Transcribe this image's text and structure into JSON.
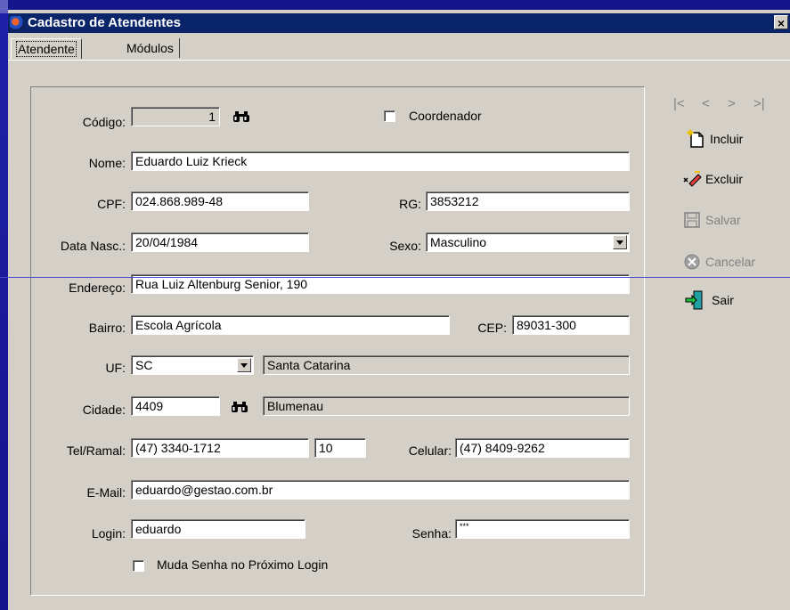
{
  "window": {
    "title": "Cadastro de Atendentes",
    "close_glyph": "×"
  },
  "tabs": [
    {
      "label": "Atendente"
    },
    {
      "label": "Módulos"
    }
  ],
  "form": {
    "codigo": {
      "label": "Código:",
      "value": "1"
    },
    "coordenador": {
      "label": "Coordenador",
      "checked": false
    },
    "nome": {
      "label": "Nome:",
      "value": "Eduardo Luiz Krieck"
    },
    "cpf": {
      "label": "CPF:",
      "value": "024.868.989-48"
    },
    "rg": {
      "label": "RG:",
      "value": "3853212"
    },
    "data_nasc": {
      "label": "Data Nasc.:",
      "value": "20/04/1984"
    },
    "sexo": {
      "label": "Sexo:",
      "value": "Masculino"
    },
    "endereco": {
      "label": "Endereço:",
      "value": "Rua Luiz Altenburg Senior, 190"
    },
    "bairro": {
      "label": "Bairro:",
      "value": "Escola Agrícola"
    },
    "cep": {
      "label": "CEP:",
      "value": "89031-300"
    },
    "uf": {
      "label": "UF:",
      "value": "SC",
      "desc": "Santa Catarina"
    },
    "cidade": {
      "label": "Cidade:",
      "value": "4409",
      "desc": "Blumenau"
    },
    "tel": {
      "label": "Tel/Ramal:",
      "value": "(47) 3340-1712",
      "ramal": "10"
    },
    "celular": {
      "label": "Celular:",
      "value": "(47) 8409-9262"
    },
    "email": {
      "label": "E-Mail:",
      "value": "eduardo@gestao.com.br"
    },
    "login": {
      "label": "Login:",
      "value": "eduardo"
    },
    "senha": {
      "label": "Senha:",
      "value": "***"
    },
    "muda_senha": {
      "label": "Muda Senha no Próximo Login",
      "checked": false
    }
  },
  "nav": {
    "first": "|<",
    "prev": "<",
    "next": ">",
    "last": ">|"
  },
  "actions": {
    "incluir": {
      "label": "Incluir",
      "icon": "new-document-icon"
    },
    "excluir": {
      "label": "Excluir",
      "icon": "eraser-icon"
    },
    "salvar": {
      "label": "Salvar",
      "icon": "save-disk-icon",
      "enabled": false
    },
    "cancelar": {
      "label": "Cancelar",
      "icon": "cancel-icon",
      "enabled": false
    },
    "sair": {
      "label": "Sair",
      "icon": "exit-door-icon"
    }
  },
  "colors": {
    "titlebar": "#0a246a",
    "window_bg": "#d4d0c8",
    "desktop": "#18189a"
  }
}
